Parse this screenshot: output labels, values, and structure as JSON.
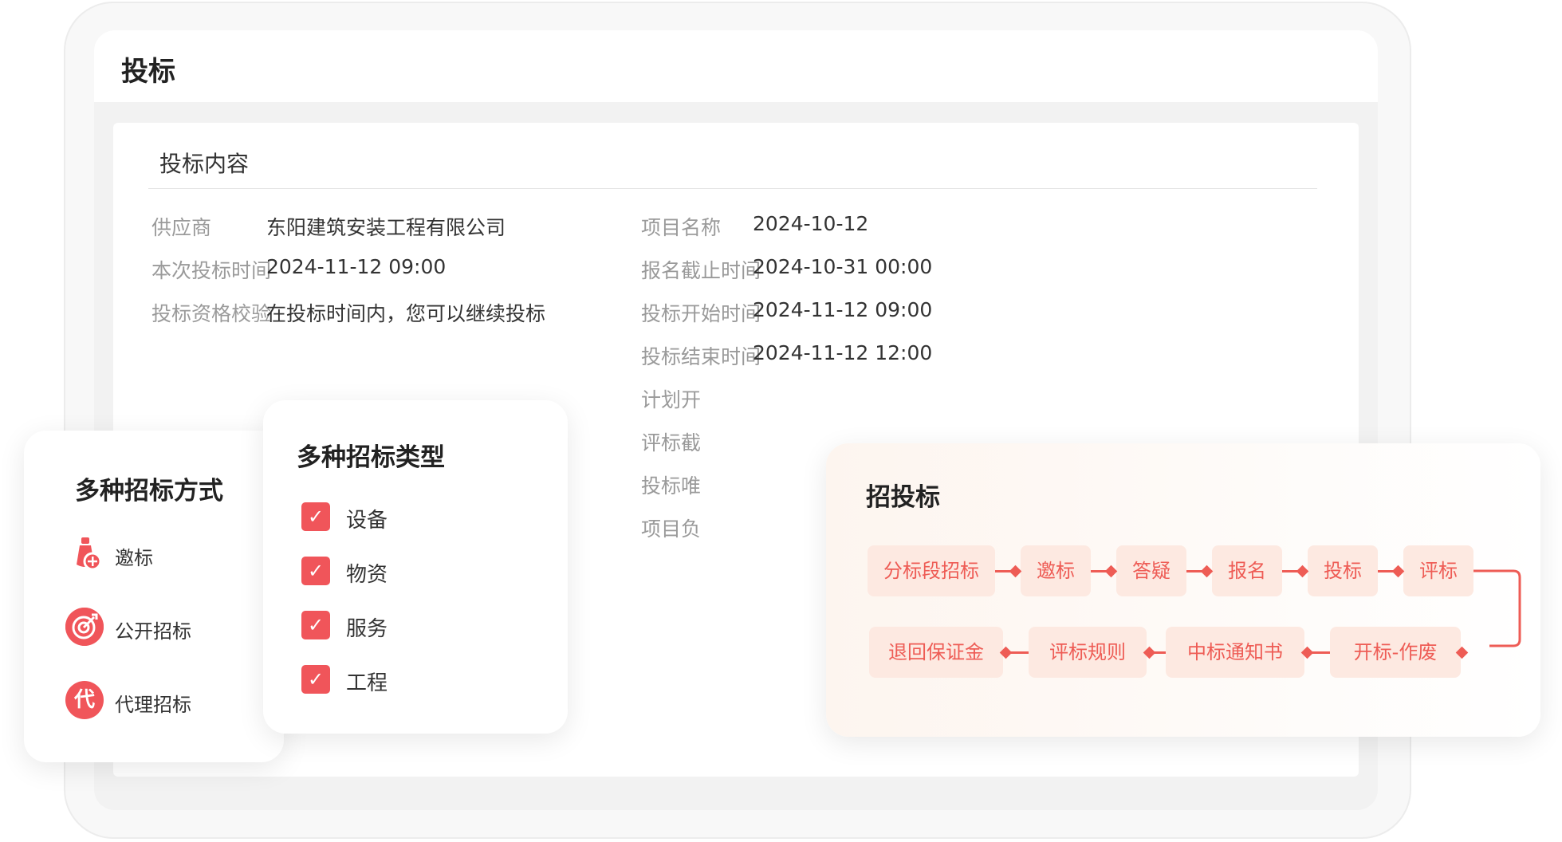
{
  "page_title": "投标",
  "section_title": "投标内容",
  "left_fields": [
    {
      "label": "供应商",
      "value": "东阳建筑安装工程有限公司"
    },
    {
      "label": "本次投标时间",
      "value": "2024-11-12 09:00"
    },
    {
      "label": "投标资格校验",
      "value": "在投标时间内，您可以继续投标"
    }
  ],
  "right_fields": [
    {
      "label": "项目名称",
      "value": "2024-10-12"
    },
    {
      "label": "报名截止时间",
      "value": "2024-10-31 00:00"
    },
    {
      "label": "投标开始时间",
      "value": "2024-11-12 09:00"
    },
    {
      "label": "投标结束时间",
      "value": "2024-11-12 12:00"
    },
    {
      "label": "计划开"
    },
    {
      "label": "评标截"
    },
    {
      "label": "投标唯"
    },
    {
      "label": "项目负"
    }
  ],
  "methods_panel": {
    "title": "多种招标方式",
    "items": [
      {
        "label": "邀标",
        "icon": "invite-icon"
      },
      {
        "label": "公开招标",
        "icon": "target-icon"
      },
      {
        "label": "代理招标",
        "icon": "agent-icon",
        "glyph": "代"
      }
    ]
  },
  "types_panel": {
    "title": "多种招标类型",
    "items": [
      {
        "label": "设备",
        "checked": true
      },
      {
        "label": "物资",
        "checked": true
      },
      {
        "label": "服务",
        "checked": true
      },
      {
        "label": "工程",
        "checked": true
      }
    ]
  },
  "flow_panel": {
    "title": "招投标",
    "row1": [
      "分标段招标",
      "邀标",
      "答疑",
      "报名",
      "投标",
      "评标"
    ],
    "row2": [
      "退回保证金",
      "评标规则",
      "中标通知书",
      "开标-作废"
    ]
  },
  "colors": {
    "accent": "#f0555a",
    "flow_node_bg": "#fde9e1",
    "flow_text": "#ee5c55",
    "label_gray": "#9a9a9a"
  }
}
